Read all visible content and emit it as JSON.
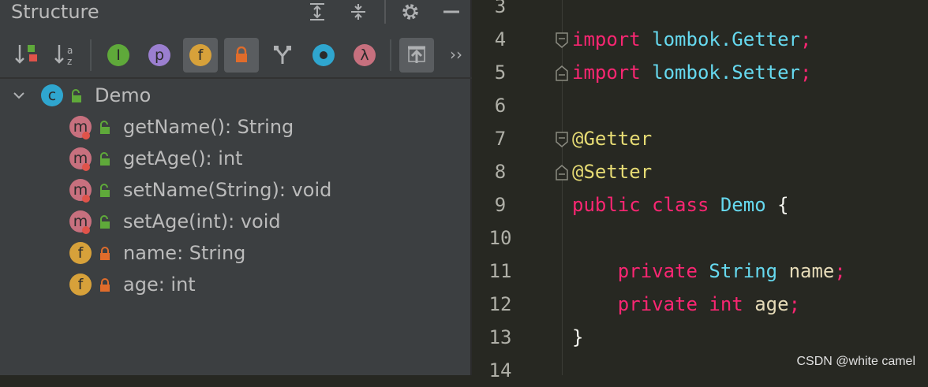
{
  "panel": {
    "title": "Structure",
    "overflow_label": "››"
  },
  "toolbar_icons": {
    "inherited_letter": "I",
    "properties_letter": "p",
    "fields_letter": "f",
    "lambda_letter": "λ",
    "alpha_letters": "a z"
  },
  "tree": {
    "root": {
      "icon_letter": "c",
      "label": "Demo"
    },
    "members": [
      {
        "kind": "method",
        "icon_letter": "m",
        "label": "getName(): String"
      },
      {
        "kind": "method",
        "icon_letter": "m",
        "label": "getAge(): int"
      },
      {
        "kind": "method",
        "icon_letter": "m",
        "label": "setName(String): void"
      },
      {
        "kind": "method",
        "icon_letter": "m",
        "label": "setAge(int): void"
      },
      {
        "kind": "field",
        "icon_letter": "f",
        "label": "name: String"
      },
      {
        "kind": "field",
        "icon_letter": "f",
        "label": "age: int"
      }
    ]
  },
  "editor": {
    "line_numbers": [
      "3",
      "4",
      "5",
      "6",
      "7",
      "8",
      "9",
      "10",
      "11",
      "12",
      "13",
      "14"
    ],
    "lines": {
      "l4": [
        "import",
        " ",
        "lombok.Getter",
        ";"
      ],
      "l5": [
        "import",
        " ",
        "lombok.Setter",
        ";"
      ],
      "l7": [
        "@Getter"
      ],
      "l8": [
        "@Setter"
      ],
      "l9": [
        "public",
        " ",
        "class",
        " ",
        "Demo",
        " {"
      ],
      "l11": [
        "    ",
        "private",
        " ",
        "String",
        " ",
        "name",
        ";"
      ],
      "l12": [
        "    ",
        "private",
        " ",
        "int",
        " ",
        "age",
        ";"
      ],
      "l13": [
        "}"
      ]
    }
  },
  "watermark": "CSDN @white camel",
  "colors": {
    "panel_bg": "#3c3f41",
    "editor_bg": "#272822",
    "keyword": "#f92672",
    "type": "#66d9ef",
    "annotation": "#e6db74",
    "method_icon": "#c7707e",
    "field_icon": "#d7a13a",
    "class_icon": "#2fa6cf",
    "lock_public": "#5fa93a",
    "lock_private": "#e06c2b"
  }
}
